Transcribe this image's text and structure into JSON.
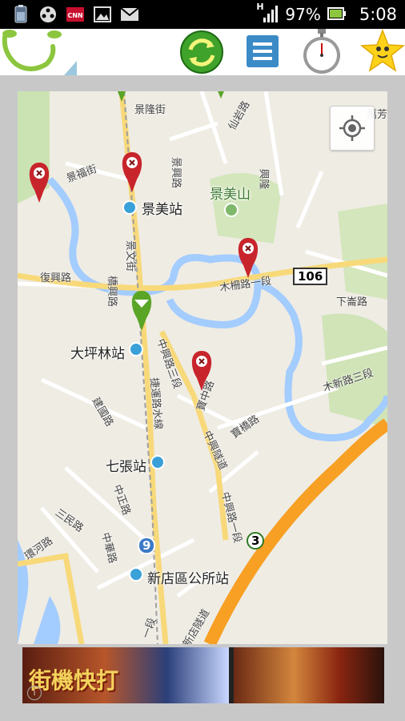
{
  "status_bar": {
    "signal_label": "H",
    "battery": "97%",
    "time": "5:08",
    "notification_icons": [
      "battery-widget-icon",
      "film-reel-icon",
      "cnn-icon",
      "gallery-icon",
      "gmail-icon"
    ]
  },
  "app_bar": {
    "logo": "smile-logo-icon",
    "actions": [
      "refresh-icon",
      "menu-icon",
      "stopwatch-icon",
      "star-icon"
    ]
  },
  "map": {
    "stations": [
      {
        "name": "景美站"
      },
      {
        "name": "大坪林站"
      },
      {
        "name": "七張站"
      },
      {
        "name": "新店區公所站"
      }
    ],
    "roads": [
      "景隆街",
      "仙岩路",
      "景福街",
      "景興路",
      "興隆",
      "景文街",
      "復興路",
      "橋興路",
      "木柵路一段",
      "下崙路",
      "中興路三段",
      "寶中路",
      "捷運路水線",
      "木新路三段",
      "建國路",
      "寶橋路",
      "中興路一段",
      "中興隧道",
      "中正路",
      "三民路",
      "中華路",
      "環河路",
      "新店隧道",
      "一段",
      "萬芳"
    ],
    "places": [
      "景美山"
    ],
    "highway_shields": [
      "106",
      "9",
      "3"
    ]
  },
  "ad": {
    "title": "街機快打"
  },
  "colors": {
    "water": "#a3ccff",
    "arterial": "#f8d97a",
    "highway": "#f7a024",
    "pin_red": "#c8242c",
    "pin_green": "#5aa526"
  }
}
